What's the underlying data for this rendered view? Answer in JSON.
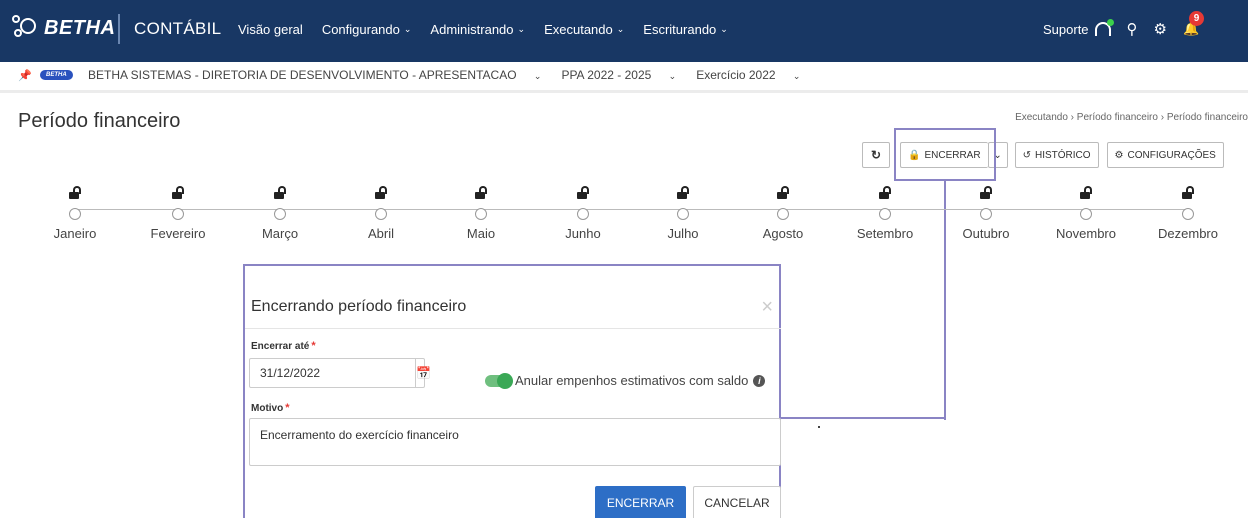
{
  "navbar": {
    "brand": "BETHA",
    "app_name": "CONTÁBIL",
    "menu": [
      {
        "label": "Visão geral",
        "has_dropdown": false
      },
      {
        "label": "Configurando",
        "has_dropdown": true
      },
      {
        "label": "Administrando",
        "has_dropdown": true
      },
      {
        "label": "Executando",
        "has_dropdown": true
      },
      {
        "label": "Escriturando",
        "has_dropdown": true
      }
    ],
    "support_label": "Suporte",
    "notification_count": "9",
    "bg_color": "#183764"
  },
  "context": {
    "entity": "BETHA SISTEMAS - DIRETORIA DE DESENVOLVIMENTO - APRESENTACAO",
    "ppa": "PPA 2022 - 2025",
    "exercise": "Exercício 2022",
    "logo_text": "BETHA"
  },
  "page": {
    "title": "Período financeiro",
    "breadcrumb": "Executando › Período financeiro › Período financeiro"
  },
  "toolbar": {
    "refresh_icon": "refresh-icon",
    "close_label": "ENCERRAR",
    "history_label": "HISTÓRICO",
    "settings_label": "CONFIGURAÇÕES"
  },
  "timeline": {
    "months": [
      "Janeiro",
      "Fevereiro",
      "Março",
      "Abril",
      "Maio",
      "Junho",
      "Julho",
      "Agosto",
      "Setembro",
      "Outubro",
      "Novembro",
      "Dezembro"
    ],
    "state": "unlocked"
  },
  "modal": {
    "title": "Encerrando período financeiro",
    "close_until_label": "Encerrar até",
    "close_until_value": "31/12/2022",
    "toggle_label": "Anular empenhos estimativos com saldo",
    "toggle_on": true,
    "reason_label": "Motivo",
    "reason_value": "Encerramento do exercício financeiro",
    "confirm_label": "ENCERRAR",
    "cancel_label": "CANCELAR",
    "required_mark": "*",
    "primary_color": "#2d6ec6",
    "toggle_color": "#3aa856"
  }
}
